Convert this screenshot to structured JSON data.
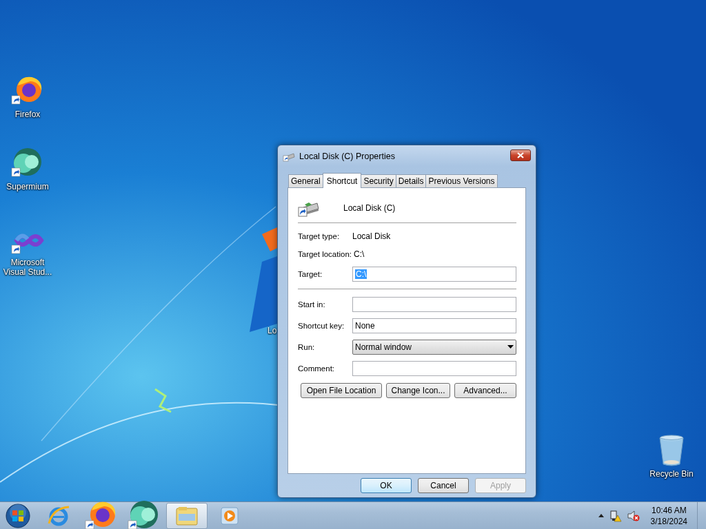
{
  "desktop": {
    "icons": [
      {
        "label": "Firefox",
        "kind": "firefox"
      },
      {
        "label": "Supermium",
        "kind": "supermium"
      },
      {
        "label": "Microsoft Visual Stud...",
        "kind": "vs"
      },
      {
        "label": "Lo",
        "kind": "hidden"
      },
      {
        "label": "Recycle Bin",
        "kind": "recycle"
      }
    ]
  },
  "dialog": {
    "title": "Local Disk (C) Properties",
    "tabs": [
      {
        "label": "General",
        "selected": false
      },
      {
        "label": "Shortcut",
        "selected": true
      },
      {
        "label": "Security",
        "selected": false
      },
      {
        "label": "Details",
        "selected": false
      },
      {
        "label": "Previous Versions",
        "selected": false
      }
    ],
    "header": "Local Disk (C)",
    "info": [
      {
        "label": "Target type:",
        "value": "Local Disk"
      },
      {
        "label": "Target location:",
        "value": "C:\\"
      }
    ],
    "target": {
      "label": "Target:",
      "value": "C:\\",
      "highlighted": true
    },
    "fields": [
      {
        "label": "Start in:",
        "kind": "text"
      },
      {
        "label": "Shortcut key:",
        "kind": "text",
        "value": "None"
      },
      {
        "label": "Run:",
        "kind": "dropdown",
        "value": "Normal window"
      },
      {
        "label": "Comment:",
        "kind": "text"
      }
    ],
    "actions": [
      "Open File Location",
      "Change Icon...",
      "Advanced..."
    ],
    "footer": [
      {
        "label": "OK",
        "default": true,
        "disabled": false
      },
      {
        "label": "Cancel",
        "default": false,
        "disabled": false
      },
      {
        "label": "Apply",
        "default": false,
        "disabled": true
      }
    ]
  },
  "taskbar": {
    "items": [
      {
        "kind": "ie",
        "selected": false
      },
      {
        "kind": "firefox",
        "selected": false
      },
      {
        "kind": "supermium",
        "selected": false
      },
      {
        "kind": "explorer",
        "selected": true
      },
      {
        "kind": "media",
        "selected": false
      }
    ],
    "time": "10:46 AM",
    "date": "3/18/2024"
  }
}
